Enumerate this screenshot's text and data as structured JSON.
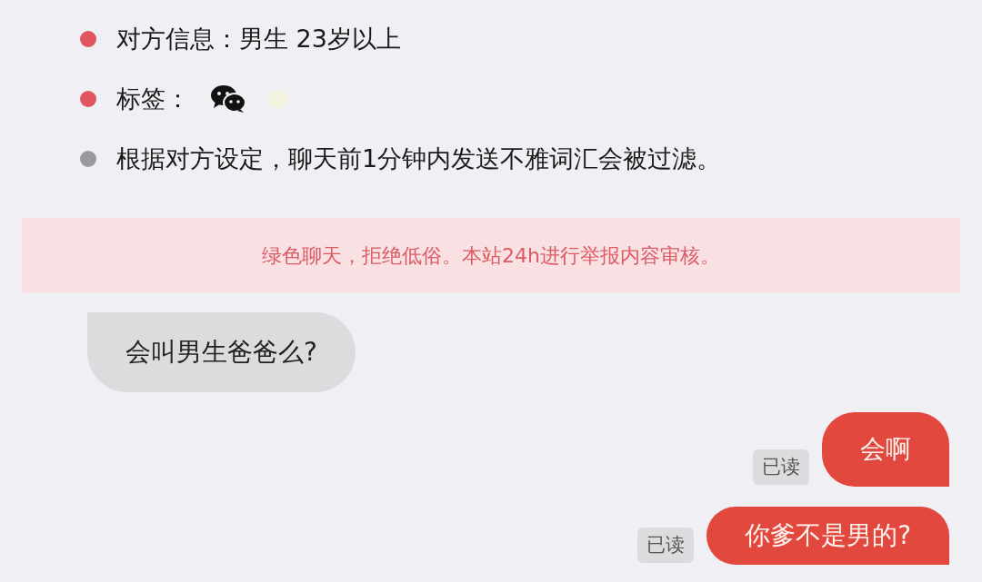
{
  "info_items": [
    {
      "kind": "text",
      "color": "#e0555e",
      "label": "对方信息：",
      "value": "男生 23岁以上"
    },
    {
      "kind": "tags",
      "color": "#e0555e",
      "label": "标签："
    },
    {
      "kind": "text",
      "color": "#9a9a9e",
      "label": "根据对方设定，聊天前1分钟内发送不雅词汇会被过滤。"
    }
  ],
  "notice": "绿色聊天，拒绝低俗。本站24h进行举报内容审核。",
  "messages": [
    {
      "kind": "incoming",
      "text": "会叫男生爸爸么?"
    },
    {
      "kind": "outgoing",
      "text": "会啊",
      "receipt": "已读"
    },
    {
      "kind": "outgoing",
      "text": "你爹不是男的?",
      "receipt": "已读"
    }
  ]
}
